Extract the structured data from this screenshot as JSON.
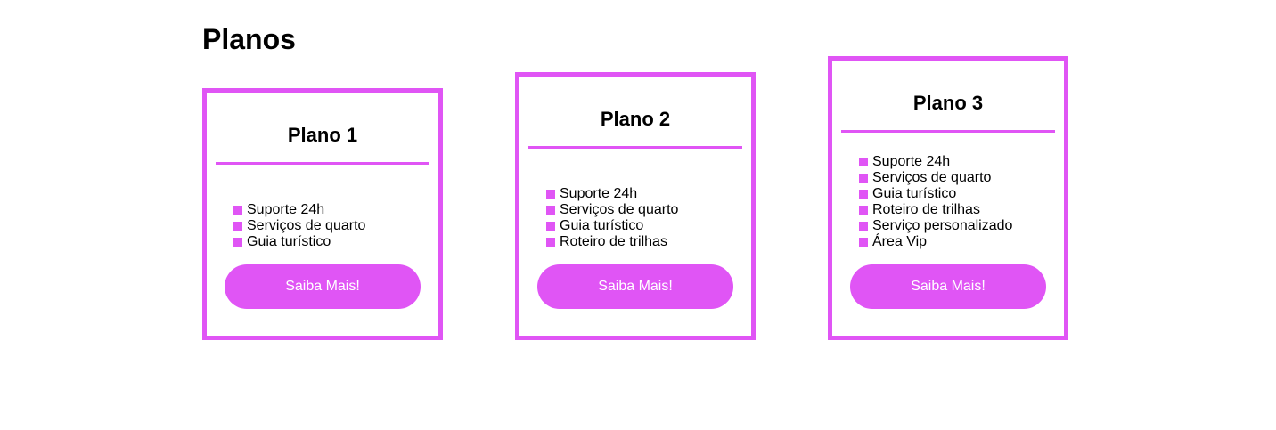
{
  "page": {
    "title": "Planos"
  },
  "theme": {
    "accent": "#e055f5",
    "text": "#000000",
    "button_text": "#ffffff",
    "background": "#ffffff"
  },
  "plans": [
    {
      "title": "Plano 1",
      "features": [
        "Suporte 24h",
        "Serviços de quarto",
        "Guia turístico"
      ],
      "button_label": "Saiba Mais!"
    },
    {
      "title": "Plano 2",
      "features": [
        "Suporte 24h",
        "Serviços de quarto",
        "Guia turístico",
        "Roteiro de trilhas"
      ],
      "button_label": "Saiba Mais!"
    },
    {
      "title": "Plano 3",
      "features": [
        "Suporte 24h",
        "Serviços de quarto",
        "Guia turístico",
        "Roteiro de trilhas",
        "Serviço personalizado",
        "Área Vip"
      ],
      "button_label": "Saiba Mais!"
    }
  ]
}
